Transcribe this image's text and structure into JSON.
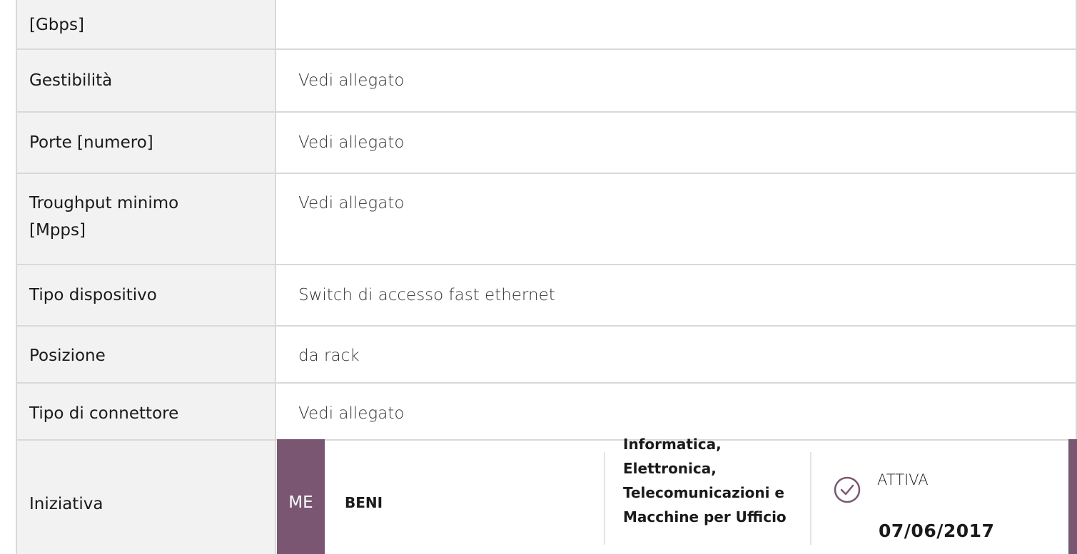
{
  "rows": [
    {
      "label": "[Gbps]",
      "value": ""
    },
    {
      "label": "Gestibilità",
      "value": "Vedi allegato"
    },
    {
      "label": "Porte [numero]",
      "value": "Vedi allegato"
    },
    {
      "label": "Troughput minimo [Mpps]",
      "value": "Vedi allegato"
    },
    {
      "label": "Tipo dispositivo",
      "value": "Switch di accesso fast ethernet"
    },
    {
      "label": "Posizione",
      "value": "da rack"
    },
    {
      "label": "Tipo di connettore",
      "value": "Vedi allegato"
    }
  ],
  "iniziativa": {
    "label": "Iniziativa",
    "badge": "ME",
    "type": "BENI",
    "category": "Informatica, Elettronica, Telecomunicazioni e Macchine per Ufficio",
    "status": "ATTIVA",
    "date": "07/06/2017",
    "status_icon": "check-circle-icon"
  },
  "colors": {
    "accent": "#7a5672",
    "label_bg": "#f2f2f2",
    "border": "#d9d9d9"
  }
}
